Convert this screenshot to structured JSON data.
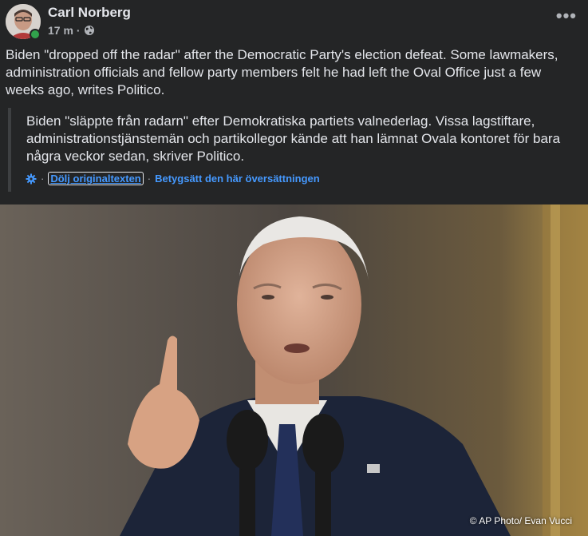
{
  "post": {
    "author": "Carl Norberg",
    "time": "17 m",
    "meta_separator": "·",
    "more_label": "•••",
    "text": "Biden \"dropped off the radar\" after the Democratic Party's election defeat. Some lawmakers, administration officials and fellow party members felt he had left the Oval Office just a few weeks ago, writes Politico."
  },
  "translation": {
    "original_text": "Biden \"släppte från radarn\" efter Demokratiska partiets valnederlag. Vissa lagstiftare, administrationstjänstemän och partikollegor kände att han lämnat Ovala kontoret för bara några veckor sedan, skriver Politico.",
    "separator": "·",
    "hide_label": "Dölj originaltexten",
    "rate_label": "Betygsätt den här översättningen"
  },
  "photo": {
    "credit": "© AP Photo/ Evan Vucci"
  },
  "icons": {
    "online": "online-status-dot",
    "globe": "globe-icon",
    "gear": "gear-icon",
    "more": "more-options-icon"
  },
  "colors": {
    "background": "#242526",
    "text": "#e4e6eb",
    "secondary_text": "#b0b3b8",
    "link": "#4599ff",
    "online": "#31a24c"
  }
}
